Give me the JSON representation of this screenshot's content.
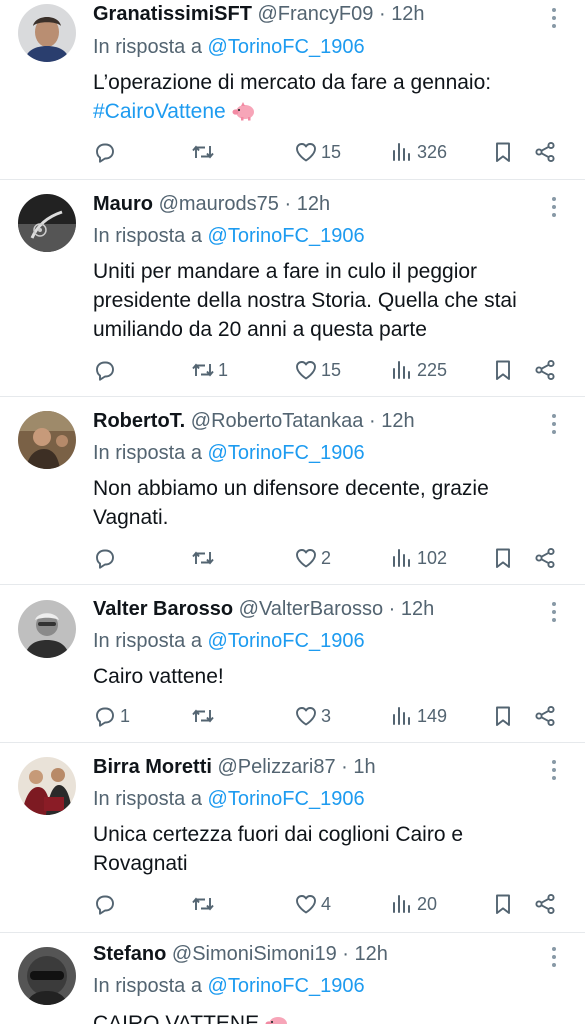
{
  "tweets": [
    {
      "name": "GranatissimiSFT",
      "handle": "@FrancyF09",
      "time": "12h",
      "reply_prefix": "In risposta a",
      "reply_to": "@TorinoFC_1906",
      "text_line1": "L’operazione di mercato da fare a gennaio:",
      "hashtag": "#CairoVattene",
      "replies": "",
      "retweets": "",
      "likes": "15",
      "views": "326"
    },
    {
      "name": "Mauro",
      "handle": "@maurods75",
      "time": "12h",
      "reply_prefix": "In risposta a",
      "reply_to": "@TorinoFC_1906",
      "text": "Uniti per mandare a fare in culo il peggior presidente della nostra Storia. Quella che stai umiliando da 20 anni a questa parte",
      "replies": "",
      "retweets": "1",
      "likes": "15",
      "views": "225"
    },
    {
      "name": "RobertoT.",
      "handle": "@RobertoTatankaa",
      "time": "12h",
      "reply_prefix": "In risposta a",
      "reply_to": "@TorinoFC_1906",
      "text": "Non abbiamo un difensore decente, grazie Vagnati.",
      "replies": "",
      "retweets": "",
      "likes": "2",
      "views": "102"
    },
    {
      "name": "Valter Barosso",
      "handle": "@ValterBarosso",
      "time": "12h",
      "reply_prefix": "In risposta a",
      "reply_to": "@TorinoFC_1906",
      "text": "Cairo vattene!",
      "replies": "1",
      "retweets": "",
      "likes": "3",
      "views": "149"
    },
    {
      "name": "Birra Moretti",
      "handle": "@Pelizzari87",
      "time": "1h",
      "reply_prefix": "In risposta a",
      "reply_to": "@TorinoFC_1906",
      "text": "Unica certezza fuori dai coglioni Cairo e Rovagnati",
      "replies": "",
      "retweets": "",
      "likes": "4",
      "views": "20"
    },
    {
      "name": "Stefano",
      "handle": "@SimoniSimoni19",
      "time": "12h",
      "reply_prefix": "In risposta a",
      "reply_to": "@TorinoFC_1906",
      "text": "CAIRO VATTENE"
    }
  ],
  "separator": "·",
  "icons": [
    "reply-icon",
    "retweet-icon",
    "like-icon",
    "views-icon",
    "bookmark-icon",
    "share-icon",
    "more-icon",
    "pig-emoji-icon"
  ],
  "colors": {
    "link": "#1d9bf0",
    "muted": "#536471",
    "text": "#0f1419",
    "divider": "#e6e9ec"
  }
}
